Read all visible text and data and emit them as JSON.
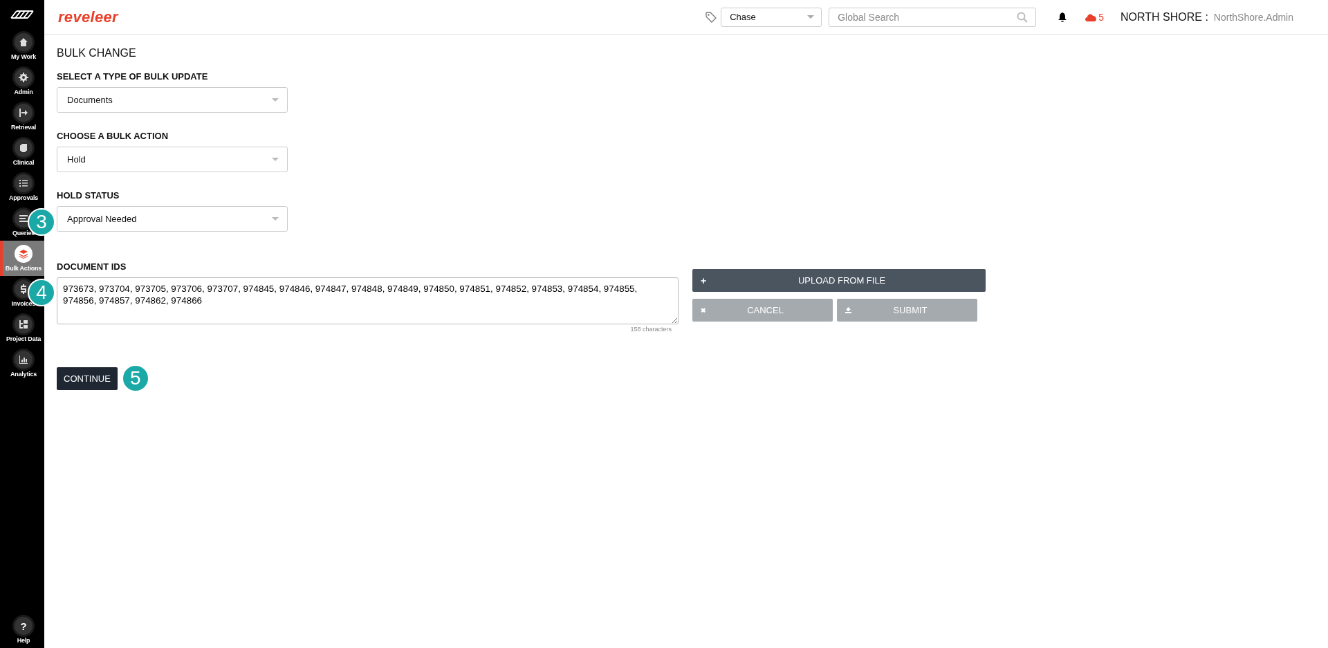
{
  "brand": "reveleer",
  "sidebar": {
    "items": [
      {
        "label": "My Work",
        "selected": false
      },
      {
        "label": "Admin",
        "selected": false
      },
      {
        "label": "Retrieval",
        "selected": false
      },
      {
        "label": "Clinical",
        "selected": false
      },
      {
        "label": "Approvals",
        "selected": false
      },
      {
        "label": "Queries",
        "selected": false,
        "badge": "3"
      },
      {
        "label": "Bulk Actions",
        "selected": true
      },
      {
        "label": "Invoices",
        "selected": false,
        "badge": "4"
      },
      {
        "label": "Project Data",
        "selected": false
      },
      {
        "label": "Analytics",
        "selected": false
      }
    ],
    "help": {
      "label": "Help",
      "glyph": "?"
    }
  },
  "topbar": {
    "project_select": {
      "value": "Chase"
    },
    "search": {
      "placeholder": "Global Search"
    },
    "cloud_count": "5",
    "org": "NORTH SHORE :",
    "user": "NorthShore.Admin"
  },
  "page": {
    "title": "BULK CHANGE",
    "fields": [
      {
        "label": "SELECT A TYPE OF BULK UPDATE",
        "value": "Documents"
      },
      {
        "label": "CHOOSE A BULK ACTION",
        "value": "Hold"
      },
      {
        "label": "HOLD STATUS",
        "value": "Approval Needed"
      }
    ],
    "document_ids": {
      "label": "DOCUMENT IDS",
      "value": "973673, 973704, 973705, 973706, 973707, 974845, 974846, 974847, 974848, 974849, 974850, 974851, 974852, 974853, 974854, 974855, 974856, 974857, 974862, 974866",
      "counter": "158 characters"
    },
    "upload_button": {
      "glyph": "+",
      "label": "UPLOAD FROM FILE"
    },
    "cancel_button": {
      "glyph": "✖",
      "label": "CANCEL",
      "disabled": true
    },
    "submit_button": {
      "label": "SUBMIT",
      "disabled": true
    },
    "continue_button": {
      "label": "CONTINUE",
      "badge": "5"
    }
  }
}
